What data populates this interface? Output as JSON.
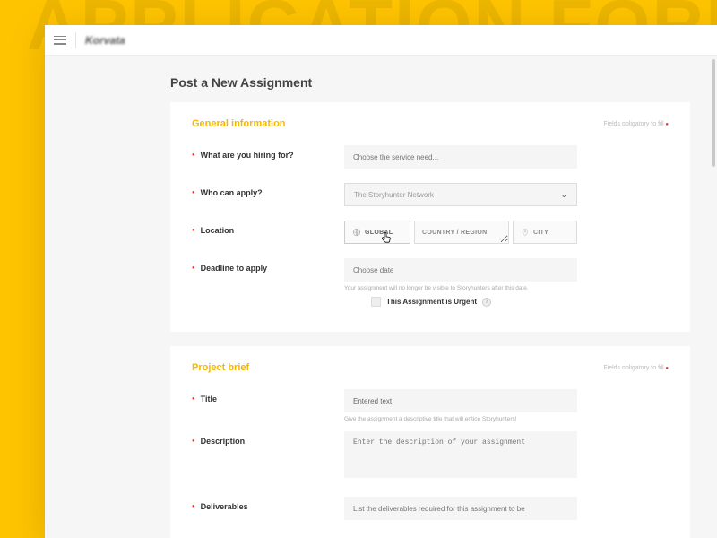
{
  "bg_text": "APPLICATION FORMS",
  "logo": "Korvata",
  "page_title": "Post a New Assignment",
  "obligatory": "Fields obligatory to fill",
  "sections": {
    "general": {
      "title": "General information",
      "hiring_label": "What are you hiring for?",
      "hiring_placeholder": "Choose the service need...",
      "who_label": "Who can apply?",
      "who_value": "The Storyhunter Network",
      "location_label": "Location",
      "loc_global": "GLOBAL",
      "loc_region": "COUNTRY / REGION",
      "loc_city": "CITY",
      "deadline_label": "Deadline to apply",
      "deadline_placeholder": "Choose date",
      "deadline_helper": "Your assignment will no longer be visible to Storyhunters after this date.",
      "urgent_label": "This Assignment is Urgent"
    },
    "brief": {
      "title": "Project brief",
      "title_label": "Title",
      "title_value": "Entered text",
      "title_helper": "Give the assignment a descriptive title that will entice Storyhunters!",
      "desc_label": "Description",
      "desc_placeholder": "Enter the description of your assignment",
      "deliv_label": "Deliverables",
      "deliv_placeholder": "List the deliverables required for this assignment to be"
    }
  }
}
